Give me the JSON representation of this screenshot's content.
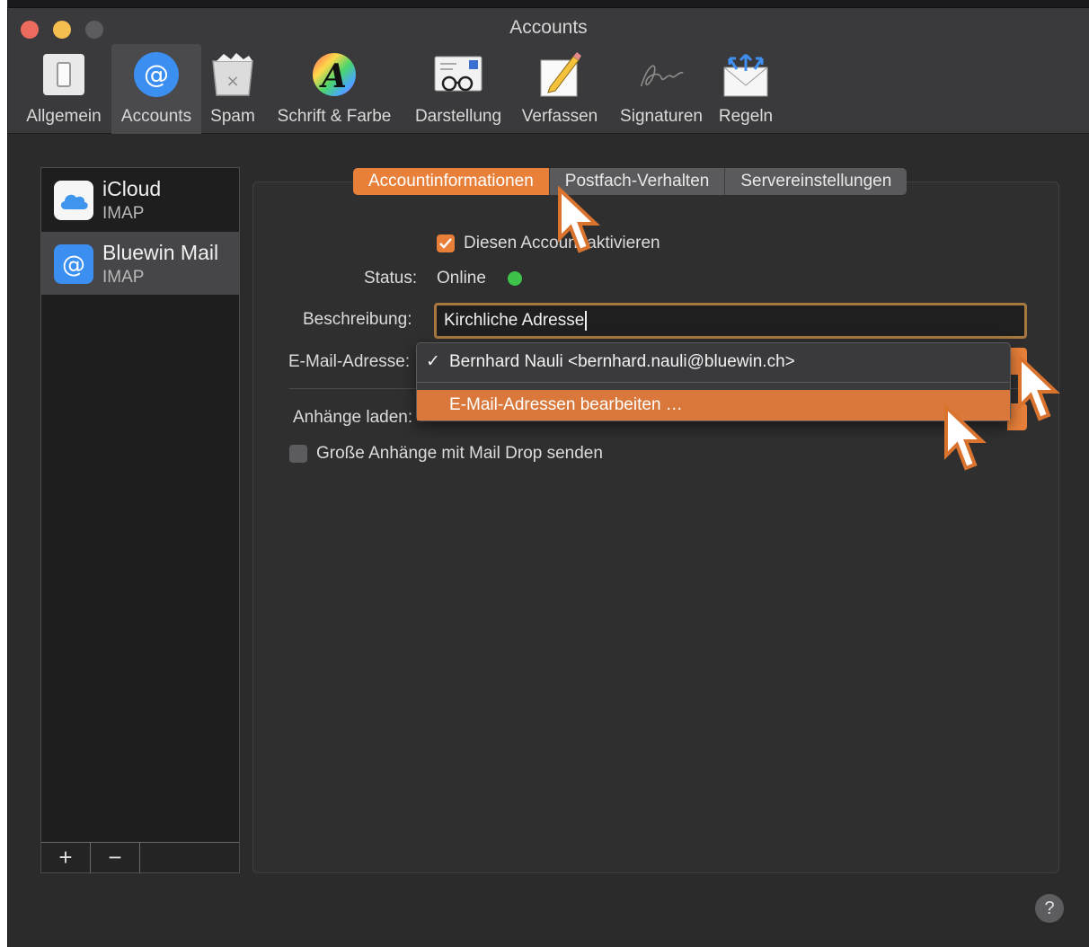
{
  "window": {
    "title": "Accounts"
  },
  "toolbar": {
    "items": [
      {
        "label": "Allgemein",
        "icon": "switch-icon"
      },
      {
        "label": "Accounts",
        "icon": "at-icon",
        "selected": true
      },
      {
        "label": "Spam",
        "icon": "trash-icon"
      },
      {
        "label": "Schrift & Farbe",
        "icon": "font-color-icon"
      },
      {
        "label": "Darstellung",
        "icon": "glasses-letter-icon"
      },
      {
        "label": "Verfassen",
        "icon": "pencil-paper-icon"
      },
      {
        "label": "Signaturen",
        "icon": "signature-icon"
      },
      {
        "label": "Regeln",
        "icon": "rules-envelope-icon"
      }
    ]
  },
  "sidebar": {
    "accounts": [
      {
        "name": "iCloud",
        "type": "IMAP",
        "icon": "icloud-icon"
      },
      {
        "name": "Bluewin Mail",
        "type": "IMAP",
        "icon": "at-icon",
        "selected": true
      }
    ],
    "add_label": "+",
    "remove_label": "−"
  },
  "tabs": [
    {
      "label": "Accountinformationen",
      "active": true
    },
    {
      "label": "Postfach-Verhalten"
    },
    {
      "label": "Servereinstellungen"
    }
  ],
  "form": {
    "enable_account_label": "Diesen Account aktivieren",
    "enable_account_checked": true,
    "status_label": "Status:",
    "status_value": "Online",
    "description_label": "Beschreibung:",
    "description_value": "Kirchliche Adresse",
    "email_label": "E-Mail-Adresse:",
    "attachments_label": "Anhänge laden:",
    "mail_drop_label": "Große Anhänge mit Mail Drop senden",
    "mail_drop_checked": false
  },
  "dropdown": {
    "selected_item": "Bernhard Nauli <bernhard.nauli@bluewin.ch>",
    "check_mark": "✓",
    "edit_item": "E-Mail-Adressen bearbeiten …"
  },
  "help_label": "?",
  "colors": {
    "accent": "#e8803a",
    "status_online": "#3ec34a",
    "window_bg": "#2b2b2c"
  }
}
